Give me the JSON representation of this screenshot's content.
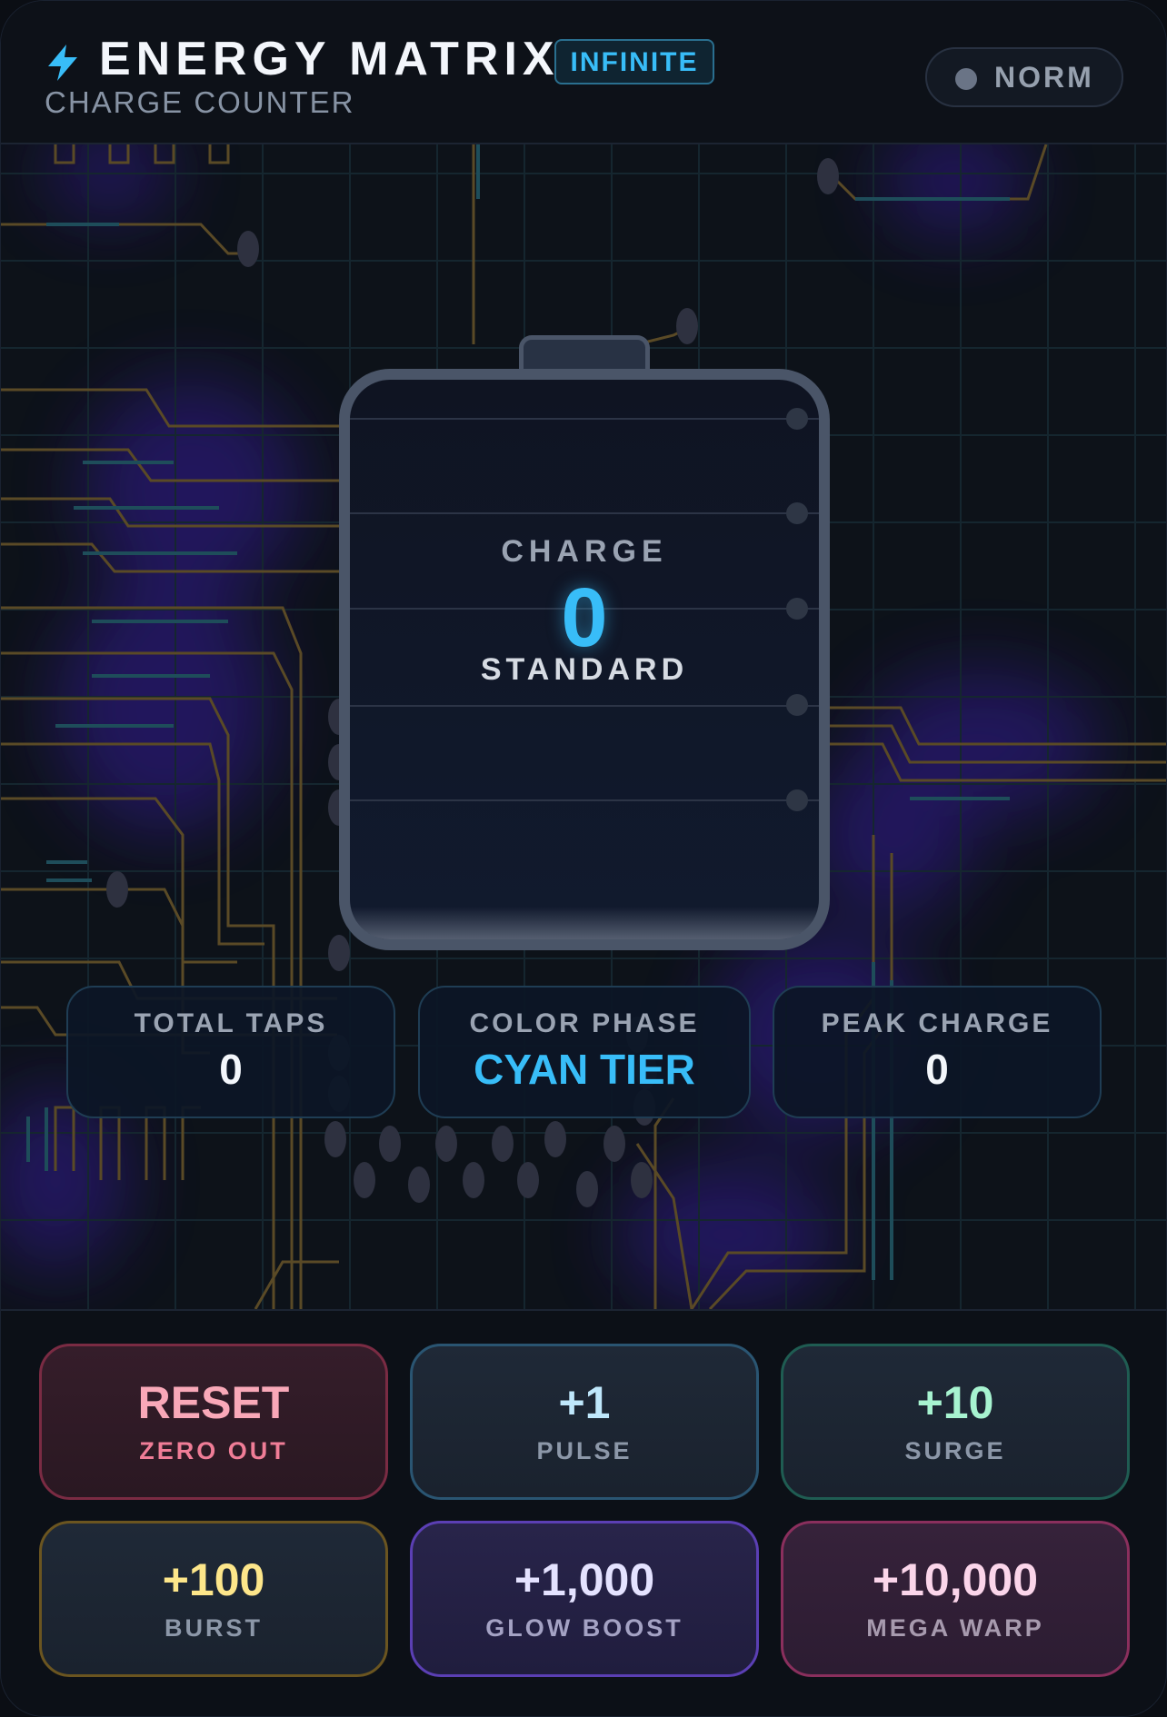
{
  "header": {
    "title": "ENERGY MATRIX",
    "badge": "INFINITE",
    "subtitle": "CHARGE COUNTER",
    "mode": "NORM",
    "bolt_icon": "lightning-bolt-icon",
    "accent_color": "#38bdf8"
  },
  "battery": {
    "label": "CHARGE",
    "value": "0",
    "tier": "STANDARD",
    "fill_fraction": 0
  },
  "stats": [
    {
      "label": "TOTAL TAPS",
      "value": "0"
    },
    {
      "label": "COLOR PHASE",
      "value": "CYAN TIER"
    },
    {
      "label": "PEAK CHARGE",
      "value": "0"
    }
  ],
  "buttons": [
    {
      "main": "RESET",
      "sub": "ZERO OUT"
    },
    {
      "main": "+1",
      "sub": "PULSE"
    },
    {
      "main": "+10",
      "sub": "SURGE"
    },
    {
      "main": "+100",
      "sub": "BURST"
    },
    {
      "main": "+1,000",
      "sub": "GLOW BOOST"
    },
    {
      "main": "+10,000",
      "sub": "MEGA WARP"
    }
  ]
}
